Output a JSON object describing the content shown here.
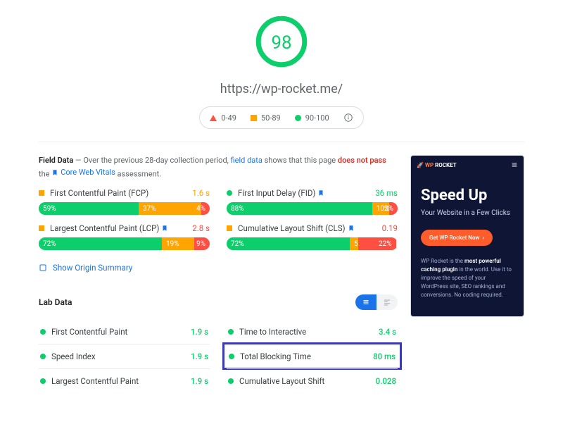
{
  "gauge": {
    "score": 98,
    "url": "https://wp-rocket.me/"
  },
  "legend": {
    "poor": "0-49",
    "avg": "50-89",
    "good": "90-100"
  },
  "field": {
    "title": "Field Data",
    "desc_pre": "— Over the previous 28-day collection period, ",
    "link1": "field data",
    "desc_mid": " shows that this page ",
    "fail": "does not pass",
    "desc_post": " the ",
    "cwv_link": "Core Web Vitals",
    "assessment": " assessment.",
    "metrics": [
      {
        "name": "First Contentful Paint (FCP)",
        "val": "1.6 s",
        "color": "orange",
        "badge": false,
        "marker": "avg",
        "g": 59,
        "o": 37,
        "r": 4
      },
      {
        "name": "First Input Delay (FID) ",
        "val": "36 ms",
        "color": "green",
        "badge": true,
        "marker": "good",
        "g": 88,
        "o": 10,
        "r": 2
      },
      {
        "name": "Largest Contentful Paint (LCP) ",
        "val": "2.8 s",
        "color": "red",
        "badge": true,
        "marker": "avg",
        "g": 72,
        "o": 19,
        "r": 9
      },
      {
        "name": "Cumulative Layout Shift (CLS) ",
        "val": "0.19",
        "color": "red",
        "badge": true,
        "marker": "avg",
        "g": 72,
        "o": 5,
        "r": 22
      }
    ],
    "origin_link": "Show Origin Summary"
  },
  "lab": {
    "title": "Lab Data",
    "rows": [
      {
        "name": "First Contentful Paint",
        "val": "1.9 s",
        "color": "green"
      },
      {
        "name": "Time to Interactive",
        "val": "3.4 s",
        "color": "green"
      },
      {
        "name": "Speed Index",
        "val": "1.9 s",
        "color": "green"
      },
      {
        "name": "Total Blocking Time",
        "val": "80 ms",
        "color": "green",
        "highlight": true
      },
      {
        "name": "Largest Contentful Paint",
        "val": "1.9 s",
        "color": "green"
      },
      {
        "name": "Cumulative Layout Shift",
        "val": "0.028",
        "color": "green"
      }
    ]
  },
  "phone": {
    "brand_pre": "WP",
    "brand_post": "ROCKET",
    "headline": "Speed Up",
    "tagline": "Your Website in a Few Clicks",
    "cta": "Get WP Rocket Now",
    "desc1": "WP Rocket is the ",
    "desc_strong": "most powerful caching plugin",
    "desc2": " in the world. Use it to improve the speed of your WordPress site, SEO rankings and conversions. No coding required."
  }
}
